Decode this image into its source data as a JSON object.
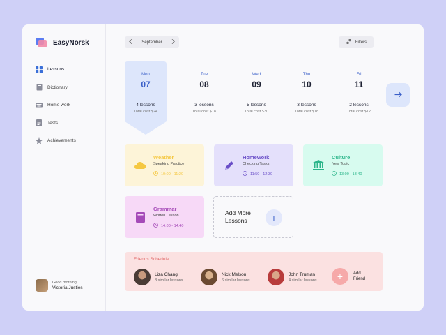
{
  "app": {
    "name": "EasyNorsk"
  },
  "sidebar": {
    "items": [
      {
        "label": "Lessons",
        "icon": "grid-icon"
      },
      {
        "label": "Dictionary",
        "icon": "book-icon"
      },
      {
        "label": "Home work",
        "icon": "keyboard-icon"
      },
      {
        "label": "Tests",
        "icon": "document-icon"
      },
      {
        "label": "Achievements",
        "icon": "star-icon"
      }
    ],
    "user": {
      "greeting": "Good morning!",
      "name": "Victoria Justies"
    }
  },
  "toolbar": {
    "month": "September",
    "filters_label": "Filters"
  },
  "days": [
    {
      "name": "Mon",
      "date": "07",
      "lessons": "4 lessons",
      "cost": "Total cost $24",
      "active": true
    },
    {
      "name": "Tue",
      "date": "08",
      "lessons": "3 lessons",
      "cost": "Total cost $18"
    },
    {
      "name": "Wed",
      "date": "09",
      "lessons": "5 lessons",
      "cost": "Total cost $30"
    },
    {
      "name": "Thu",
      "date": "10",
      "lessons": "3 lessons",
      "cost": "Total cost $18"
    },
    {
      "name": "Fri",
      "date": "11",
      "lessons": "2 lessons",
      "cost": "Total cost $12"
    }
  ],
  "lessons": [
    {
      "title": "Weather",
      "subtitle": "Speaking Practice",
      "time": "10:00 - 11:20",
      "icon": "cloud-icon",
      "bg": "#fdf4d8",
      "accent": "#f5c842"
    },
    {
      "title": "Homework",
      "subtitle": "Checking Tasks",
      "time": "11:50 - 12:30",
      "icon": "pencil-icon",
      "bg": "#e4e0fb",
      "accent": "#6a4fc8"
    },
    {
      "title": "Culture",
      "subtitle": "New Topic",
      "time": "13:00 - 13:40",
      "icon": "museum-icon",
      "bg": "#d7fbef",
      "accent": "#2bb58a"
    },
    {
      "title": "Grammar",
      "subtitle": "Written Lesson",
      "time": "14:00 - 14:40",
      "icon": "book-icon",
      "bg": "#f7d9f7",
      "accent": "#a54ab8"
    }
  ],
  "add_lessons": {
    "label": "Add More Lessons"
  },
  "friends": {
    "title": "Friends Schedule",
    "people": [
      {
        "name": "Liza Chang",
        "detail": "8 similar lessons"
      },
      {
        "name": "Nick Melson",
        "detail": "6 similar lessons"
      },
      {
        "name": "John Truman",
        "detail": "4 similar lessons"
      }
    ],
    "add_label": "Add Friend"
  }
}
